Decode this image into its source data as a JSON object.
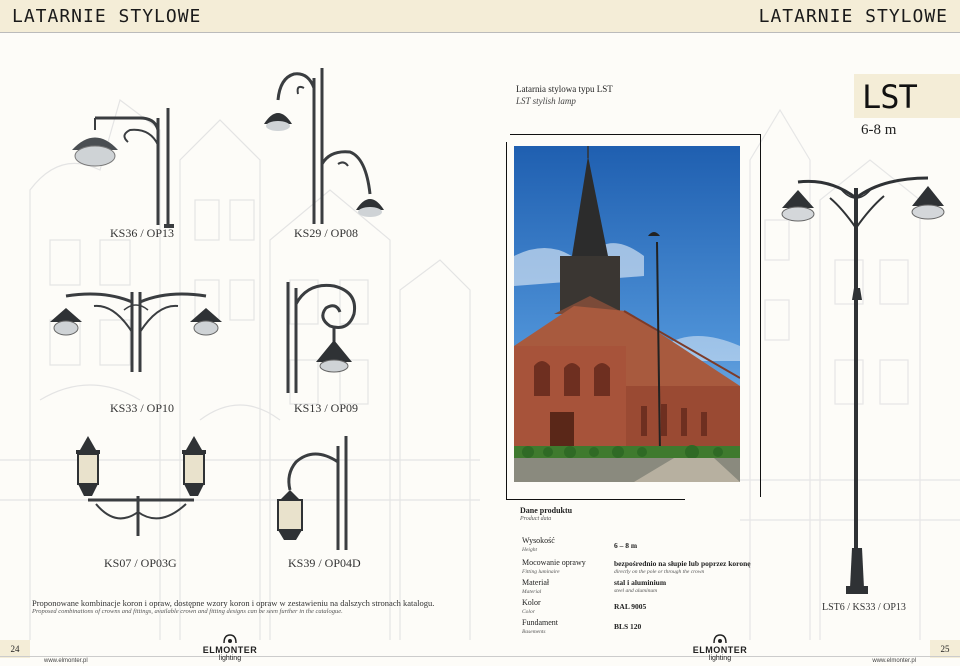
{
  "header": {
    "left_title": "LATARNIE STYLOWE",
    "right_title": "LATARNIE STYLOWE"
  },
  "left_page": {
    "page_number": "24",
    "website": "www.elmonter.pl",
    "lamps": [
      {
        "code": "KS36 / OP13"
      },
      {
        "code": "KS29 / OP08"
      },
      {
        "code": "KS33 / OP10"
      },
      {
        "code": "KS13 / OP09"
      },
      {
        "code": "KS07 / OP03G"
      },
      {
        "code": "KS39 / OP04D"
      }
    ],
    "note_pl": "Proponowane kombinacje koron i opraw, dostępne wzory koron i opraw w zestawieniu na dalszych stronach katalogu.",
    "note_en": "Proposed combinations of crowns and fittings, available crown and fitting designs can be seen further in the catalogue."
  },
  "right_page": {
    "page_number": "25",
    "website": "www.elmonter.pl",
    "product_title_pl": "Latarnia stylowa typu LST",
    "product_title_en": "LST stylish lamp",
    "model_code": "LST",
    "height_range": "6-8 m",
    "product_data_pl": "Dane produktu",
    "product_data_en": "Product data",
    "specs": [
      {
        "label_pl": "Wysokość",
        "label_en": "Height",
        "value_pl": "6 – 8 m",
        "value_en": ""
      },
      {
        "label_pl": "Mocowanie oprawy",
        "label_en": "Fitting luminaire",
        "value_pl": "bezpośrednio na słupie lub poprzez koronę",
        "value_en": "directly on the pole or through the crown"
      },
      {
        "label_pl": "Materiał",
        "label_en": "Material",
        "value_pl": "stal i aluminium",
        "value_en": "steel and aluminum"
      },
      {
        "label_pl": "Kolor",
        "label_en": "Color",
        "value_pl": "RAL 9005",
        "value_en": ""
      },
      {
        "label_pl": "Fundament",
        "label_en": "Basements",
        "value_pl": "BLS 120",
        "value_en": ""
      }
    ],
    "main_lamp_code": "LST6 / KS33 / OP13"
  },
  "logo": {
    "brand": "ELMONTER",
    "sub": "lighting"
  },
  "colors": {
    "accent_band": "#f4edd7",
    "lamp": "#3a3d40"
  }
}
